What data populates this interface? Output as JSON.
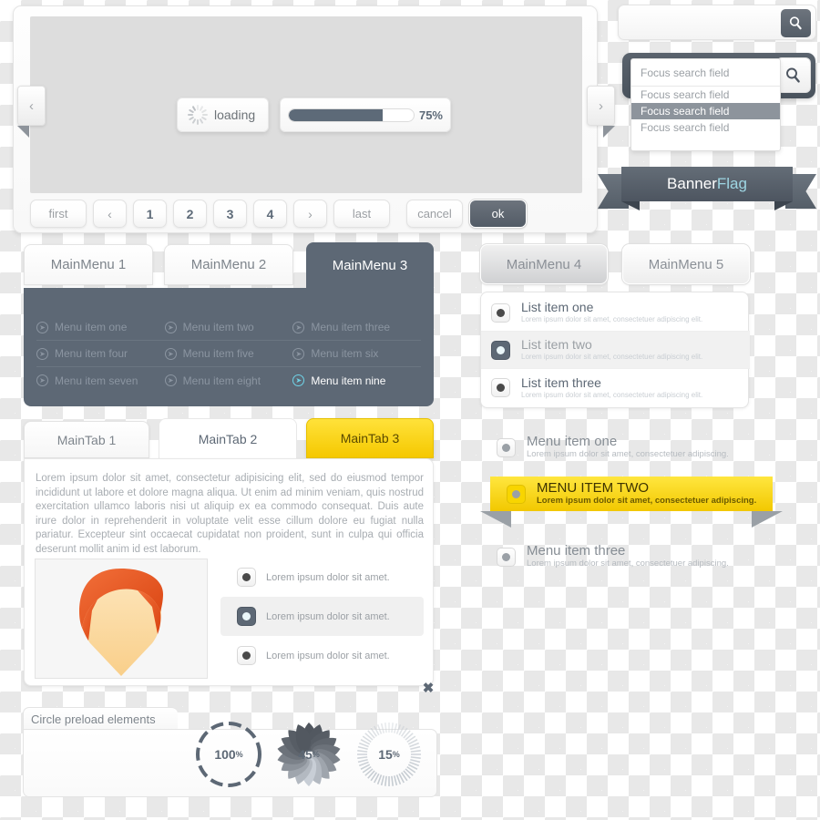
{
  "carousel": {
    "prev_icon": "chevron-left-icon",
    "next_icon": "chevron-right-icon",
    "loading_label": "loading",
    "progress": {
      "value": 75,
      "label": "75%"
    },
    "pager": {
      "first": "first",
      "prev": "‹",
      "pages": [
        "1",
        "2",
        "3",
        "4"
      ],
      "next": "›",
      "last": "last",
      "cancel": "cancel",
      "ok": "ok"
    }
  },
  "search": {
    "plain": {
      "value": "",
      "placeholder": "",
      "icon": "magnifier-icon"
    },
    "focus": {
      "icon": "magnifier-icon",
      "input_value": "Focus search field",
      "options": [
        "Focus search field",
        "Focus search field",
        "Focus search field"
      ],
      "selected_index": 1
    }
  },
  "banner": {
    "text_primary": "Banner",
    "text_accent": "Flag"
  },
  "main_menu": {
    "tabs": [
      {
        "label": "MainMenu 1",
        "active": false
      },
      {
        "label": "MainMenu 2",
        "active": false
      },
      {
        "label": "MainMenu 3",
        "active": true
      }
    ],
    "items": [
      "Menu item  one",
      "Menu item  two",
      "Menu item  three",
      "Menu item  four",
      "Menu item  five",
      "Menu item  six",
      "Menu item  seven",
      "Menu item  eight",
      "Menu item  nine"
    ],
    "highlighted_index": 8,
    "arrow_icon": "arrow-right-circle-icon"
  },
  "main_tabs": {
    "tabs": [
      {
        "label": "MainTab 1",
        "state": "inactive"
      },
      {
        "label": "MainTab 2",
        "state": "current"
      },
      {
        "label": "MainTab 3",
        "state": "highlight"
      }
    ],
    "body_text": "Lorem ipsum dolor sit amet, consectetur adipisicing elit, sed do eiusmod tempor incididunt ut labore et dolore magna aliqua. Ut enim ad minim veniam, quis nostrud exercitation ullamco laboris nisi ut aliquip ex ea commodo consequat. Duis aute irure dolor in reprehenderit in voluptate velit esse cillum dolore eu fugiat nulla pariatur. Excepteur sint occaecat cupidatat non proident, sunt in culpa qui officia deserunt mollit anim id est laborum.",
    "avatar_alt": "user-avatar",
    "radio_items": [
      {
        "label": "Lorem ipsum dolor sit amet.",
        "selected": false
      },
      {
        "label": "Lorem ipsum dolor sit amet.",
        "selected": true
      },
      {
        "label": "Lorem ipsum dolor sit amet.",
        "selected": false
      }
    ],
    "close_icon": "close-x-icon"
  },
  "circle_preload": {
    "title": "Circle preload elements",
    "circles": [
      {
        "value": "100",
        "unit": "%",
        "style": "dashed"
      },
      {
        "value": "45",
        "unit": "%",
        "style": "petals"
      },
      {
        "value": "15",
        "unit": "%",
        "style": "ticks"
      }
    ]
  },
  "right_menu": {
    "tabs": [
      {
        "label": "MainMenu 4",
        "active": true
      },
      {
        "label": "MainMenu 5",
        "active": false
      }
    ],
    "list_items": [
      {
        "title": "List item one",
        "sub": "Lorem ipsum dolor sit amet, consectetuer adipiscing elit.",
        "selected": false
      },
      {
        "title": "List item two",
        "sub": "Lorem ipsum dolor sit amet, consectetuer adipiscing elit.",
        "selected": true
      },
      {
        "title": "List item three",
        "sub": "Lorem ipsum dolor sit amet, consectetuer adipiscing elit.",
        "selected": false
      }
    ],
    "menu_items": [
      {
        "title": "Menu item one",
        "sub": "Lorem ipsum dolor sit amet, consectetuer adipiscing.",
        "highlight": false
      },
      {
        "title": "MENU ITEM TWO",
        "sub": "Lorem ipsum dolor sit amet, consectetuer adipiscing.",
        "highlight": true
      },
      {
        "title": "Menu item three",
        "sub": "Lorem ipsum dolor sit amet, consectetuer adipiscing.",
        "highlight": false
      }
    ]
  },
  "colors": {
    "slate": "#5d6875",
    "slate_dark": "#4d5560",
    "yellow": "#f5c800",
    "yellow_light": "#ffe63f",
    "accent_cyan": "#9ed6e3",
    "hair_orange": "#e8521f",
    "skin": "#fbd9a0",
    "muted_text": "#9ba0a5"
  }
}
